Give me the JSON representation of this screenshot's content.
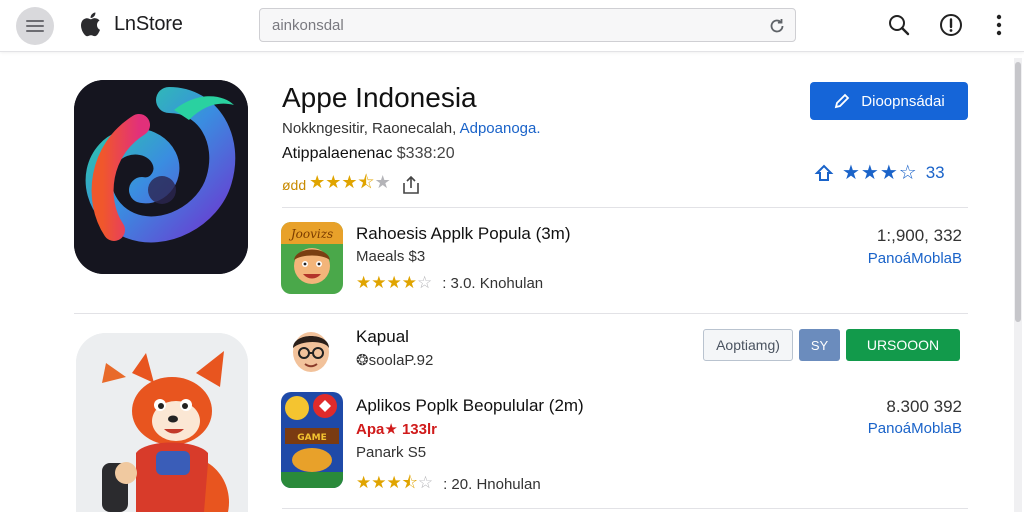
{
  "header": {
    "brand": "LnStore",
    "search_value": "ainkonsdal"
  },
  "featured": {
    "title": "Appe Indonesia",
    "subtitle_main": "Nokkngesitir, Raonecalah,",
    "subtitle_link": "Adpoanoga.",
    "meta_label": "Atippalaenenac",
    "meta_price": "$338:20",
    "rating_label": "ødd",
    "rating_stars": 3.5,
    "download_label": "Dioopnsádai",
    "rating_count": "33",
    "right_rating_stars": 2.5
  },
  "apps": [
    {
      "title": "Rahoesis Applk Popula (3m)",
      "subtitle": "Maeals $3",
      "rating_stars": 3.5,
      "reviews": ": 3.0. Knohulan",
      "count": "1:,900, 332",
      "developer": "PanoáMoblaB"
    },
    {
      "title": "Aplikos Poplk Beopulular (2m)",
      "subtitle": "Apa★ 133lr",
      "subtitle2": "Panark S5",
      "rating_stars": 3.5,
      "reviews": ": 20. Hnohulan",
      "count": "8.300 392",
      "developer": "PanoáMoblaB"
    }
  ],
  "kapual": {
    "name": "Kapual",
    "handle": "❂soolaP.92",
    "btn_outline": "Aoptiamg)",
    "btn_small": "SY",
    "btn_green": "URSOOON"
  },
  "colors": {
    "accent_blue": "#1565d8",
    "green": "#129a4b",
    "star": "#e0a400"
  },
  "icons": [
    "menu-icon",
    "apple-logo-icon",
    "reload-icon",
    "search-icon",
    "info-icon",
    "more-vertical-icon",
    "share-icon",
    "pen-icon",
    "thumbs-up-icon"
  ]
}
